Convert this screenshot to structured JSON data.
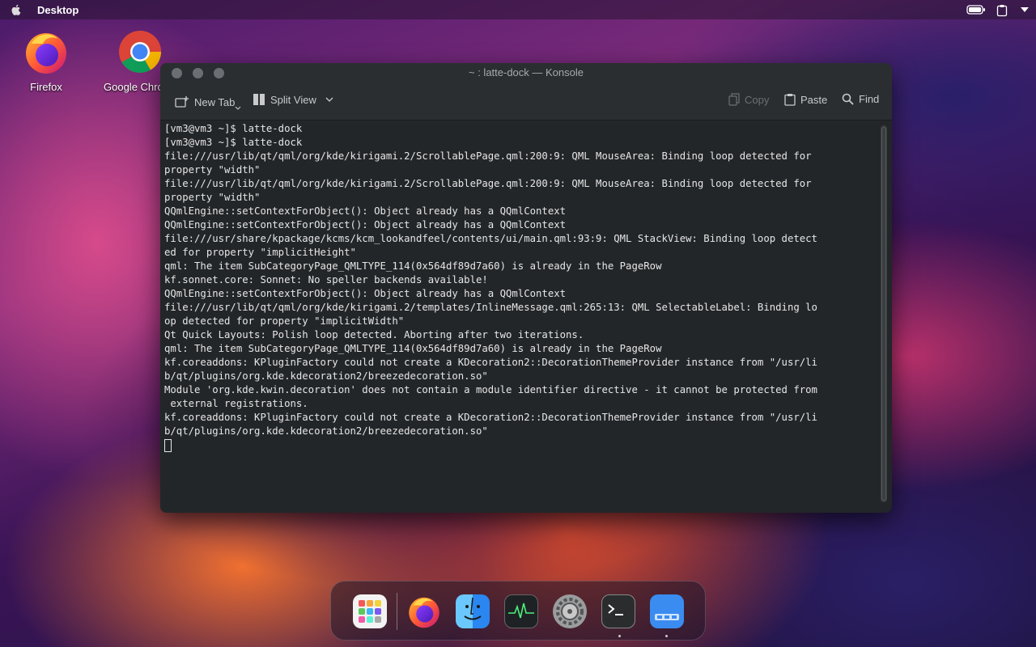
{
  "topbar": {
    "title": "Desktop",
    "icons": [
      "apple-logo-icon",
      "battery-icon",
      "clipboard-icon",
      "chevron-down-icon"
    ]
  },
  "desktop_icons": [
    {
      "label": "Firefox",
      "icon": "firefox-icon"
    },
    {
      "label": "Google Chrome",
      "icon": "chrome-icon"
    }
  ],
  "window": {
    "title": "~ : latte-dock — Konsole",
    "toolbar": {
      "new_tab": "New Tab",
      "split_view": "Split View",
      "copy": "Copy",
      "paste": "Paste",
      "find": "Find"
    },
    "terminal_lines": [
      "[vm3@vm3 ~]$ latte-dock",
      "[vm3@vm3 ~]$ latte-dock",
      "file:///usr/lib/qt/qml/org/kde/kirigami.2/ScrollablePage.qml:200:9: QML MouseArea: Binding loop detected for",
      "property \"width\"",
      "file:///usr/lib/qt/qml/org/kde/kirigami.2/ScrollablePage.qml:200:9: QML MouseArea: Binding loop detected for",
      "property \"width\"",
      "QQmlEngine::setContextForObject(): Object already has a QQmlContext",
      "QQmlEngine::setContextForObject(): Object already has a QQmlContext",
      "file:///usr/share/kpackage/kcms/kcm_lookandfeel/contents/ui/main.qml:93:9: QML StackView: Binding loop detect",
      "ed for property \"implicitHeight\"",
      "qml: The item SubCategoryPage_QMLTYPE_114(0x564df89d7a60) is already in the PageRow",
      "kf.sonnet.core: Sonnet: No speller backends available!",
      "QQmlEngine::setContextForObject(): Object already has a QQmlContext",
      "file:///usr/lib/qt/qml/org/kde/kirigami.2/templates/InlineMessage.qml:265:13: QML SelectableLabel: Binding lo",
      "op detected for property \"implicitWidth\"",
      "Qt Quick Layouts: Polish loop detected. Aborting after two iterations.",
      "qml: The item SubCategoryPage_QMLTYPE_114(0x564df89d7a60) is already in the PageRow",
      "kf.coreaddons: KPluginFactory could not create a KDecoration2::DecorationThemeProvider instance from \"/usr/li",
      "b/qt/plugins/org.kde.kdecoration2/breezedecoration.so\"",
      "Module 'org.kde.kwin.decoration' does not contain a module identifier directive - it cannot be protected from",
      " external registrations.",
      "kf.coreaddons: KPluginFactory could not create a KDecoration2::DecorationThemeProvider instance from \"/usr/li",
      "b/qt/plugins/org.kde.kdecoration2/breezedecoration.so\""
    ]
  },
  "dock": {
    "items": [
      "app-launcher-icon",
      "firefox-icon",
      "finder-icon",
      "activity-monitor-icon",
      "system-settings-icon",
      "terminal-icon",
      "desktop-icon"
    ]
  },
  "colors": {
    "terminal_bg": "#232629",
    "toolbar_bg": "#2b2e31",
    "terminal_text": "#e6e6e6"
  }
}
